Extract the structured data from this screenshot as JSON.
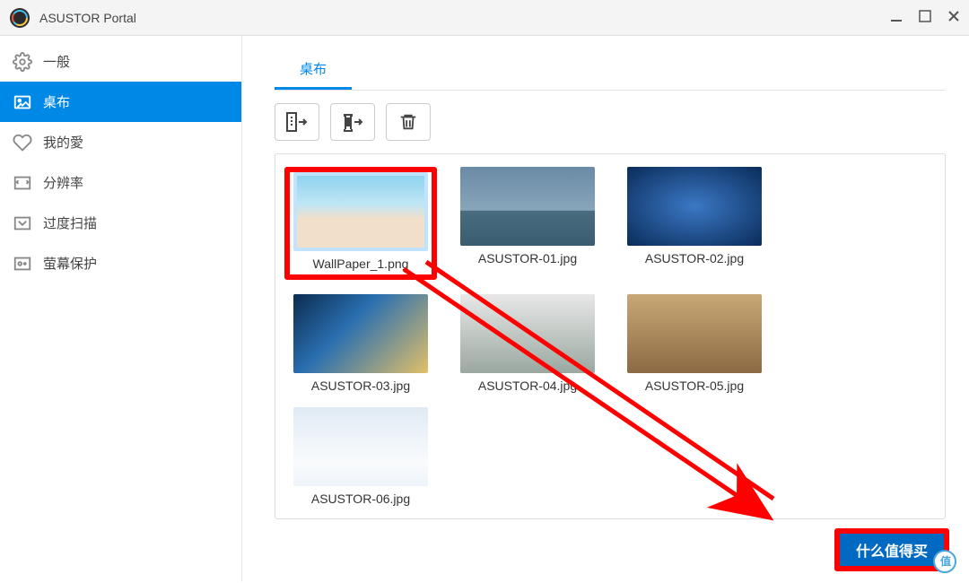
{
  "window": {
    "title": "ASUSTOR Portal"
  },
  "sidebar": {
    "items": [
      {
        "label": "一般",
        "icon": "gear-icon"
      },
      {
        "label": "桌布",
        "icon": "image-icon"
      },
      {
        "label": "我的愛",
        "icon": "heart-icon"
      },
      {
        "label": "分辨率",
        "icon": "resolution-icon"
      },
      {
        "label": "过度扫描",
        "icon": "overscan-icon"
      },
      {
        "label": "萤幕保护",
        "icon": "screensaver-icon"
      }
    ],
    "selected_index": 1
  },
  "tabs": [
    {
      "label": "桌布",
      "active": true
    }
  ],
  "toolbar": {
    "buttons": [
      {
        "name": "import-button",
        "icon": "import-icon"
      },
      {
        "name": "export-button",
        "icon": "export-icon"
      },
      {
        "name": "delete-button",
        "icon": "trash-icon"
      }
    ]
  },
  "wallpapers": [
    {
      "filename": "WallPaper_1.png",
      "selected": true
    },
    {
      "filename": "ASUSTOR-01.jpg",
      "selected": false
    },
    {
      "filename": "ASUSTOR-02.jpg",
      "selected": false
    },
    {
      "filename": "ASUSTOR-03.jpg",
      "selected": false
    },
    {
      "filename": "ASUSTOR-04.jpg",
      "selected": false
    },
    {
      "filename": "ASUSTOR-05.jpg",
      "selected": false
    },
    {
      "filename": "ASUSTOR-06.jpg",
      "selected": false
    }
  ],
  "apply_button": {
    "label": "什么值得买"
  },
  "annotation": {
    "arrow_from": "selected-wallpaper",
    "arrow_to": "apply-button",
    "color": "#ff0000"
  }
}
